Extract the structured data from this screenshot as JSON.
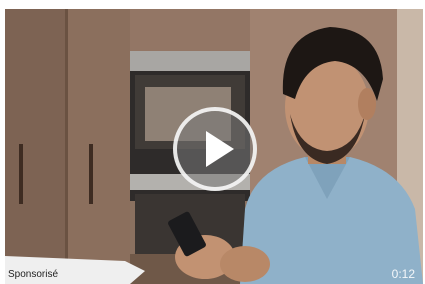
{
  "ad": {
    "sponsor_label": "Sponsorisé",
    "duration": "0:12"
  },
  "player": {
    "play_icon": "play-icon"
  }
}
